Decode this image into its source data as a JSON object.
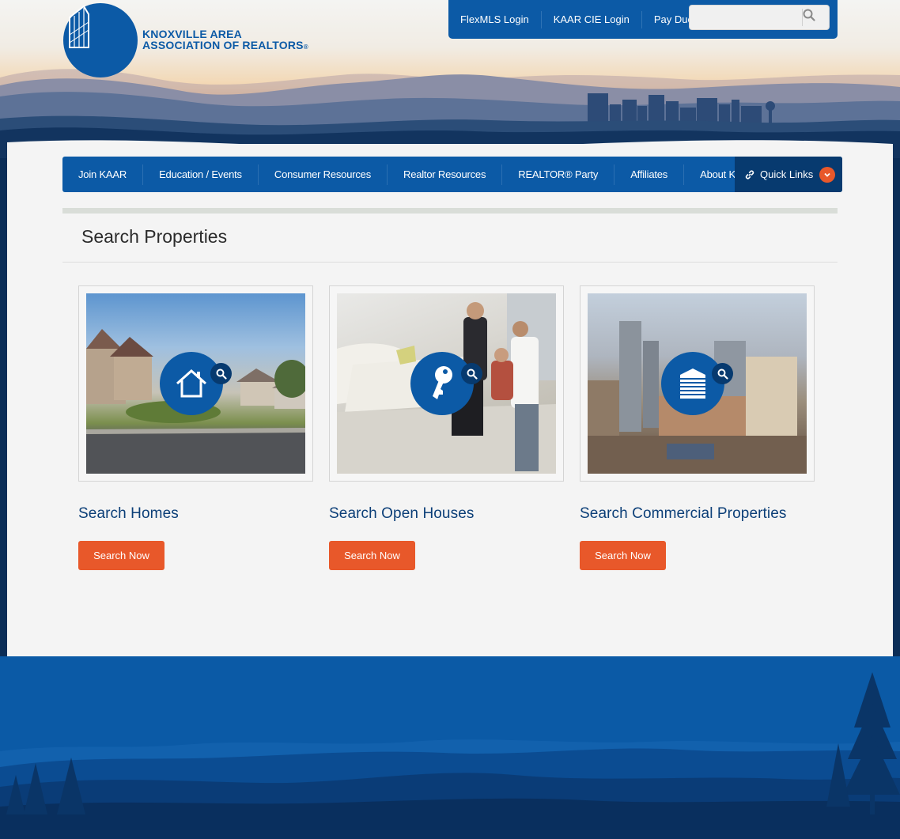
{
  "org": {
    "name_line1": "KNOXVILLE AREA",
    "name_line2": "ASSOCIATION OF REALTORS",
    "reg_mark": "®"
  },
  "utility": {
    "links": [
      "FlexMLS Login",
      "KAAR CIE Login",
      "Pay Dues"
    ],
    "search_placeholder": ""
  },
  "nav": {
    "items": [
      "Join KAAR",
      "Education / Events",
      "Consumer Resources",
      "Realtor Resources",
      "REALTOR® Party",
      "Affiliates",
      "About KAAR"
    ],
    "quick_links": "Quick Links"
  },
  "page": {
    "title": "Search Properties"
  },
  "cards": [
    {
      "title": "Search Homes",
      "button": "Search Now",
      "icon": "house-icon"
    },
    {
      "title": "Search Open Houses",
      "button": "Search Now",
      "icon": "key-icon"
    },
    {
      "title": "Search Commercial Properties",
      "button": "Search Now",
      "icon": "building-icon"
    }
  ],
  "colors": {
    "brand_blue": "#0c5aa6",
    "dark_blue": "#073a6f",
    "accent_orange": "#e8582a",
    "title_blue": "#0c3f78"
  }
}
